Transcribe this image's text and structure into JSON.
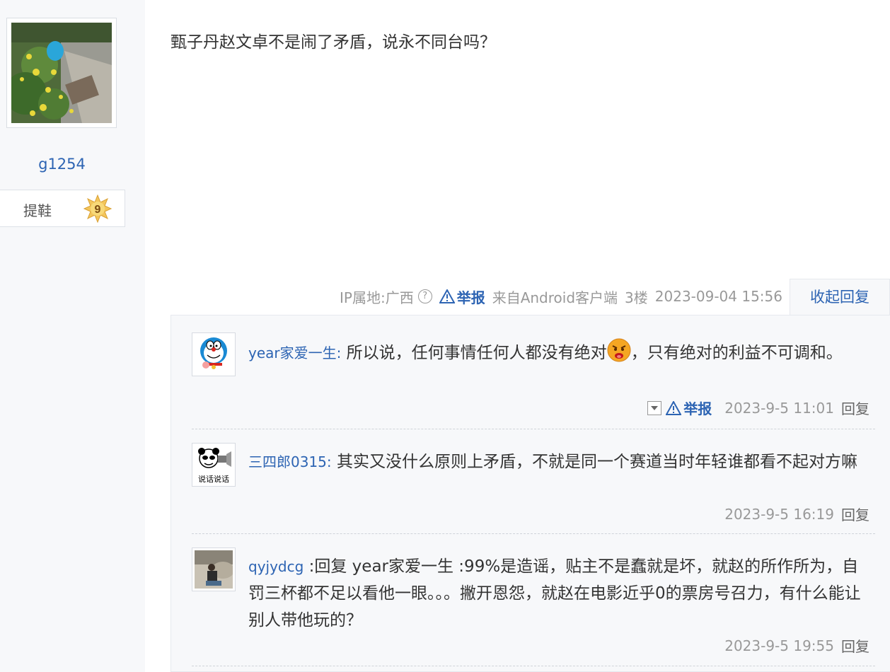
{
  "author": {
    "username": "g1254",
    "level_title": "提鞋",
    "level_number": "9"
  },
  "post": {
    "text": "甄子丹赵文卓不是闹了矛盾，说永不同台吗？",
    "ip_location": "IP属地:广西",
    "help_icon": "?",
    "report_label": "举报",
    "source": "来自Android客户端",
    "floor": "3楼",
    "timestamp": "2023-09-04 15:56",
    "collapse_label": "收起回复"
  },
  "replies": [
    {
      "name": "year家爱一生",
      "separator": ":",
      "text_before_emoji": " 所以说，任何事情任何人都没有绝对",
      "emoji": "angry-face-emoji",
      "text_after_emoji": "，只有绝对的利益不可调和。",
      "report_label": "举报",
      "time": "2023-9-5 11:01",
      "reply_label": "回复"
    },
    {
      "name": "三四郎0315",
      "separator": ":",
      "text": " 其实又没什么原则上矛盾，不就是同一个赛道当时年轻谁都看不起对方嘛",
      "avatar_caption": "说话说话",
      "time": "2023-9-5 16:19",
      "reply_label": "回复"
    },
    {
      "name": "qyjydcg",
      "separator": " :",
      "text": "回复 year家爱一生 :99%是造谣，贴主不是蠢就是坏，就赵的所作所为，自罚三杯都不足以看他一眼。。。撇开恩怨，就赵在电影近乎0的票房号召力，有什么能让别人带他玩的？",
      "time": "2023-9-5 19:55",
      "reply_label": "回复"
    }
  ],
  "colors": {
    "link": "#2d64b3",
    "meta_gray": "#999999",
    "panel_bg": "#f7f8fa"
  }
}
